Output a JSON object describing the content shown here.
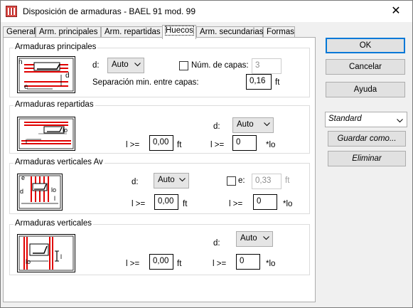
{
  "window": {
    "title": "Disposición de armaduras - BAEL 91 mod. 99",
    "close_glyph": "✕"
  },
  "tabs": [
    {
      "label": "General"
    },
    {
      "label": "Arm. principales"
    },
    {
      "label": "Arm. repartidas"
    },
    {
      "label": "Huecos",
      "active": true
    },
    {
      "label": "Arm. secundarias"
    },
    {
      "label": "Formas"
    }
  ],
  "groups": {
    "principales": {
      "title": "Armaduras principales",
      "d_label": "d:",
      "d_value": "Auto",
      "num_capas_label": "Núm. de capas:",
      "num_capas_value": "3",
      "separacion_label": "Separación min. entre capas:",
      "separacion_value": "0,16",
      "separacion_unit": "ft",
      "fig_labels": {
        "n": "n",
        "d": "d",
        "e": "e"
      }
    },
    "repartidas": {
      "title": "Armaduras repartidas",
      "d_label": "d:",
      "d_value": "Auto",
      "l_label": "l >=",
      "l_value": "0,00",
      "l_unit": "ft",
      "l2_label": "l >=",
      "l2_value": "0",
      "l2_unit": "*lo",
      "fig_labels": {
        "lo": "lo",
        "l": "l"
      }
    },
    "verticales_av": {
      "title": "Armaduras verticales Av",
      "d_label": "d:",
      "d_value": "Auto",
      "e_label": "e:",
      "e_value": "0,33",
      "e_unit": "ft",
      "l_label": "l >=",
      "l_value": "0,00",
      "l_unit": "ft",
      "l2_label": "l >=",
      "l2_value": "0",
      "l2_unit": "*lo",
      "fig_labels": {
        "e": "e",
        "d": "d",
        "lo": "lo",
        "l": "l"
      }
    },
    "verticales": {
      "title": "Armaduras verticales",
      "d_label": "d:",
      "d_value": "Auto",
      "l_label": "l >=",
      "l_value": "0,00",
      "l_unit": "ft",
      "l2_label": "l >=",
      "l2_value": "0",
      "l2_unit": "*lo",
      "fig_labels": {
        "lo": "lo",
        "l": "l"
      }
    }
  },
  "side": {
    "ok": "OK",
    "cancel": "Cancelar",
    "help": "Ayuda",
    "preset": "Standard",
    "save_as": "Guardar como...",
    "delete": "Eliminar"
  },
  "colors": {
    "accent_border": "#0078d7",
    "rebar_red": "#e00000",
    "fig_border": "#000000"
  }
}
